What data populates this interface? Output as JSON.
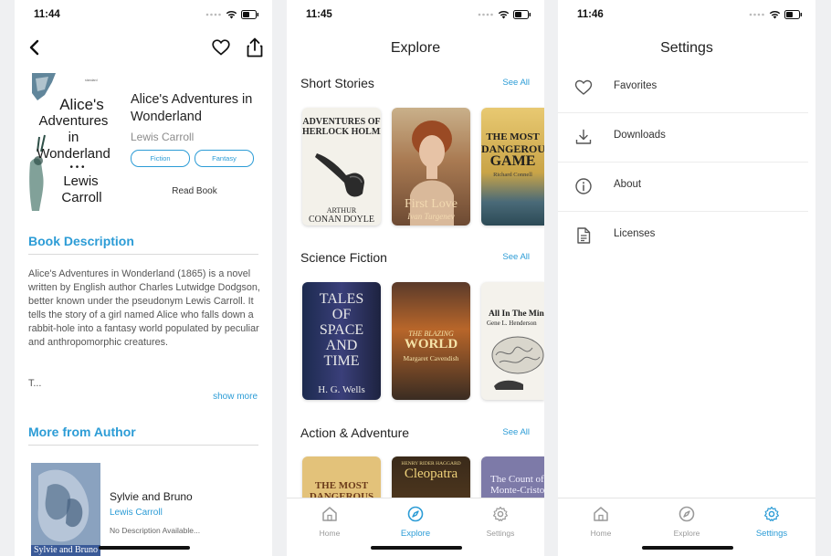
{
  "detail": {
    "time": "11:44",
    "cover_text": [
      "Alice's",
      "Adventures in",
      "Wonderland",
      "• • •",
      "Lewis",
      "Carroll"
    ],
    "title": "Alice's Adventures in Wonderland",
    "author": "Lewis Carroll",
    "genres": [
      "Fiction",
      "Fantasy"
    ],
    "read_label": "Read Book",
    "description_heading": "Book Description",
    "description": "Alice's Adventures in Wonderland (1865) is a novel written by English author Charles Lutwidge Dodgson, better known under the pseudonym Lewis Carroll. It tells the story of a girl named Alice who falls down a rabbit-hole into a fantasy world populated by peculiar and anthropomorphic creatures.",
    "description_more": "T...",
    "show_more": "show more",
    "more_heading": "More from Author",
    "more_books": [
      {
        "title": "Sylvie and Bruno",
        "author": "Lewis Carroll",
        "description": "No Description Available...",
        "cover_text": "Sylvie and Bruno"
      }
    ]
  },
  "explore": {
    "time": "11:45",
    "title": "Explore",
    "see_all": "See All",
    "sections": [
      {
        "title": "Short Stories",
        "books": [
          {
            "top": "ADVENTURES OF",
            "mid": "HERLOCK HOLME",
            "bottom": "ARTHUR",
            "bottom2": "CONAN DOYLE"
          },
          {
            "top": "First Love",
            "mid": "Ivan Turgenev"
          },
          {
            "top": "THE MOST",
            "mid": "DANGEROUS",
            "bottom": "GAME",
            "bottom2": "Richard Connell"
          }
        ]
      },
      {
        "title": "Science Fiction",
        "books": [
          {
            "top": "TALES OF SPACE AND TIME",
            "mid": "H. G. Wells"
          },
          {
            "top": "THE BLAZING",
            "mid": "WORLD",
            "bottom": "Margaret Cavendish"
          },
          {
            "top": "All In The Mind",
            "mid": "Gene L. Henderson"
          }
        ]
      },
      {
        "title": "Action & Adventure",
        "books": [
          {
            "top": "THE MOST",
            "mid": "DANGEROUS"
          },
          {
            "top": "HENRY RIDER HAGGARD",
            "mid": "Cleopatra"
          },
          {
            "top": "The Count of",
            "mid": "Monte-Cristo"
          }
        ]
      }
    ]
  },
  "settings": {
    "time": "11:46",
    "title": "Settings",
    "items": [
      {
        "label": "Favorites",
        "icon": "heart-icon"
      },
      {
        "label": "Downloads",
        "icon": "download-icon"
      },
      {
        "label": "About",
        "icon": "info-icon"
      },
      {
        "label": "Licenses",
        "icon": "document-icon"
      }
    ]
  },
  "tabs": [
    {
      "label": "Home",
      "icon": "home-icon"
    },
    {
      "label": "Explore",
      "icon": "compass-icon"
    },
    {
      "label": "Settings",
      "icon": "gear-icon"
    }
  ],
  "colors": {
    "accent": "#2c9cd6",
    "inactive": "#9a9a9a"
  }
}
